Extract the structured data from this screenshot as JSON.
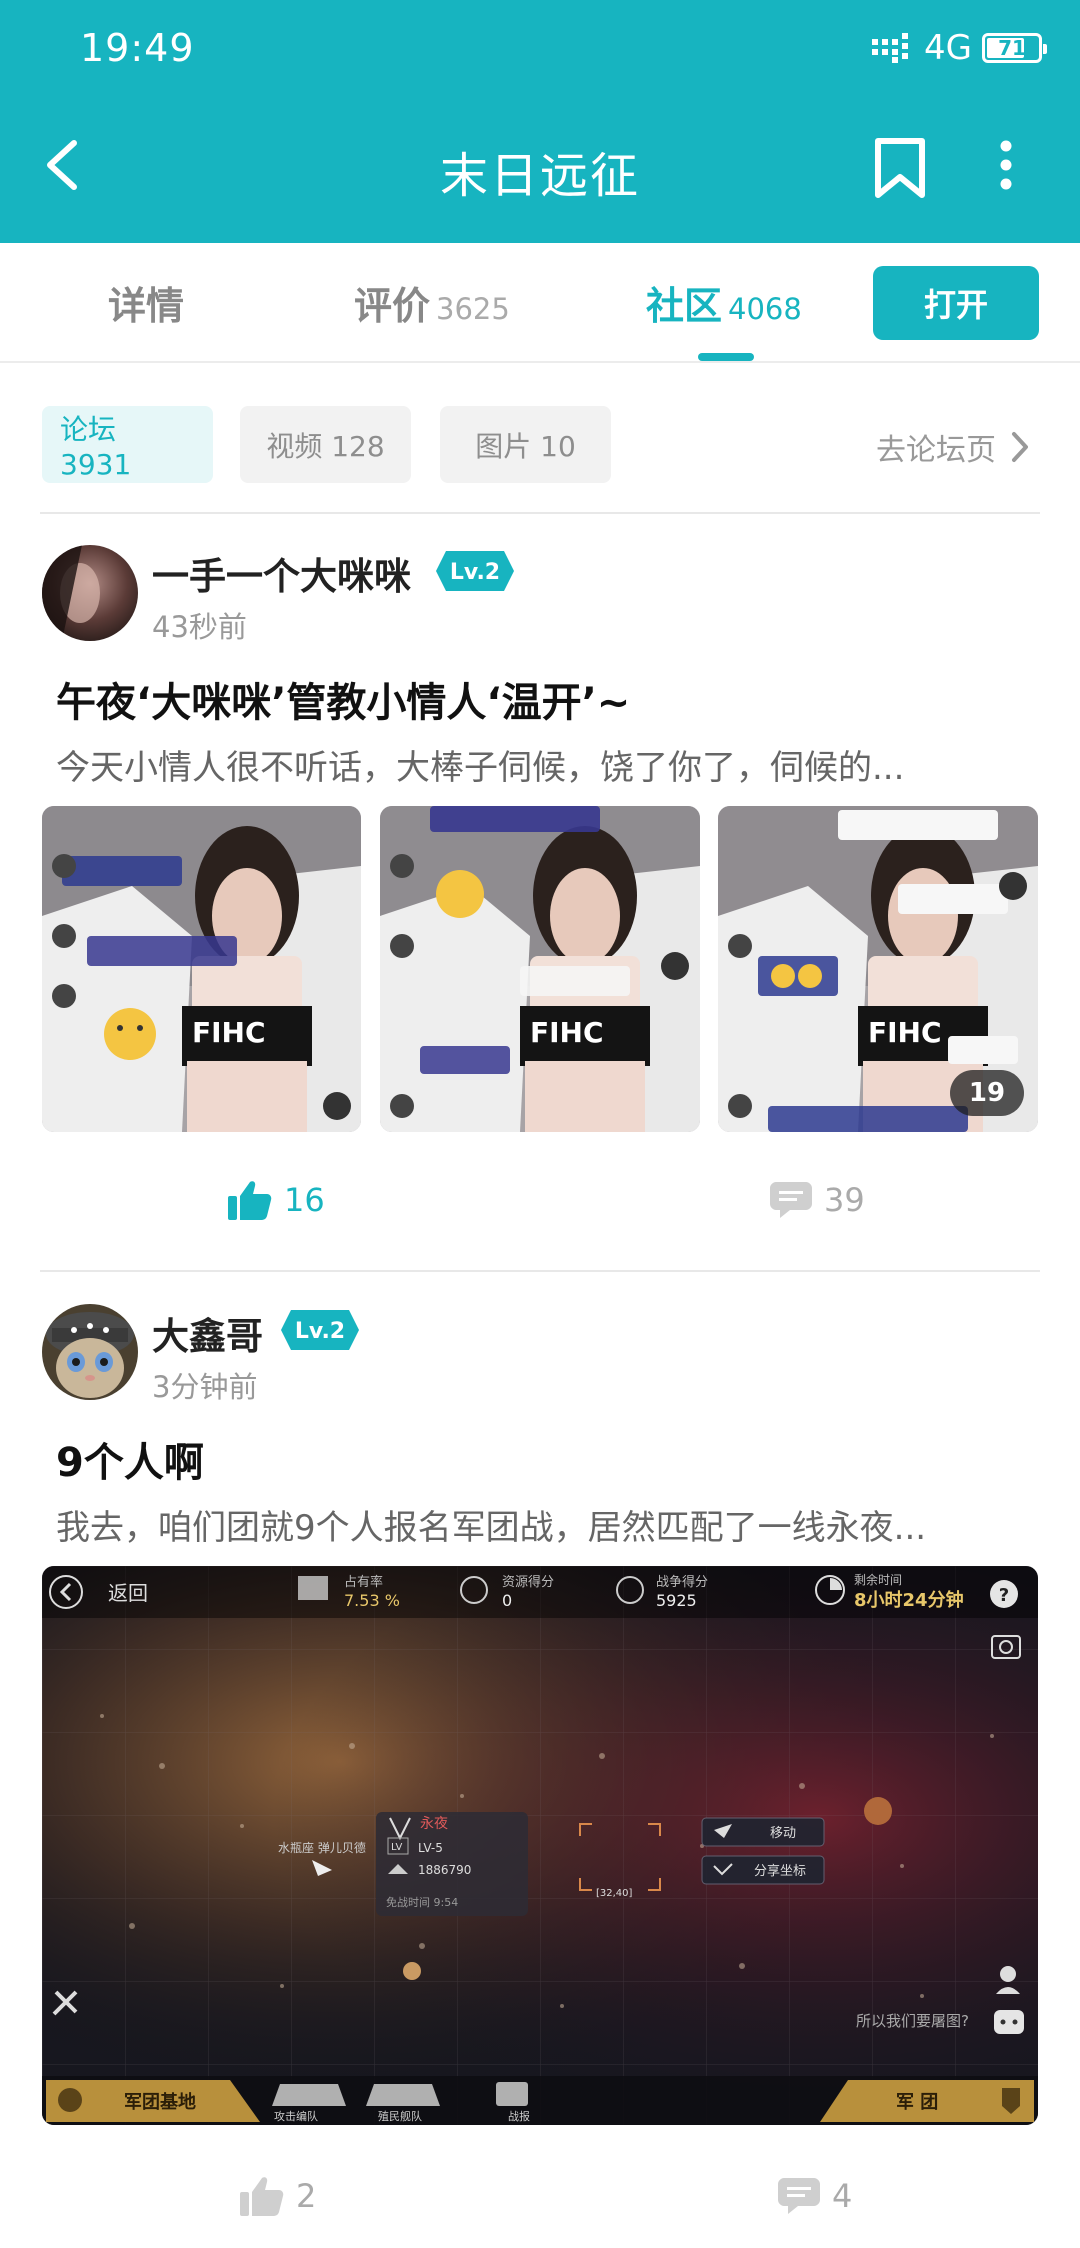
{
  "status": {
    "time": "19:49",
    "network": "4G",
    "battery": "71"
  },
  "header": {
    "title": "末日远征"
  },
  "tabs": [
    {
      "label": "详情",
      "count": ""
    },
    {
      "label": "评价",
      "count": "3625"
    },
    {
      "label": "社区",
      "count": "4068"
    }
  ],
  "open_label": "打开",
  "filters": [
    {
      "label": "论坛 3931"
    },
    {
      "label": "视频 128"
    },
    {
      "label": "图片 10"
    }
  ],
  "forum_link": "去论坛页",
  "posts": [
    {
      "username": "一手一个大咪咪",
      "level": "Lv.2",
      "time": "43秒前",
      "title": "午夜‘大咪咪’管教小情人‘温开’~",
      "excerpt": "今天小情人很不听话，大棒子伺候，饶了你了，伺候的...",
      "image_count": "19",
      "likes": "16",
      "comments": "39"
    },
    {
      "username": "大鑫哥",
      "level": "Lv.2",
      "time": "3分钟前",
      "title": "9个人啊",
      "excerpt": "我去，咱们团就9个人报名军团战，居然匹配了一线永夜...",
      "likes": "2",
      "comments": "4",
      "game": {
        "back": "返回",
        "stat1_label": "占有率",
        "stat1_value": "7.53 %",
        "stat2_label": "资源得分",
        "stat2_value": "0",
        "stat3_label": "战争得分",
        "stat3_value": "5925",
        "timer_label": "剩余时间",
        "timer_value": "8小时24分钟",
        "player_label": "水瓶座 弹儿贝德",
        "target_name": "永夜",
        "target_level": "LV-5",
        "target_power": "1886790",
        "target_protect": "免战时间 9:54",
        "coords": "[32,40]",
        "move": "移动",
        "share": "分享坐标",
        "chat_hint": "所以我们要屠图?",
        "base": "军团基地",
        "btn1": "攻击编队",
        "btn2": "殖民舰队",
        "btn3": "战报",
        "legion": "军 团"
      }
    }
  ],
  "colors": {
    "accent": "#17b4c0",
    "muted": "#999999"
  }
}
